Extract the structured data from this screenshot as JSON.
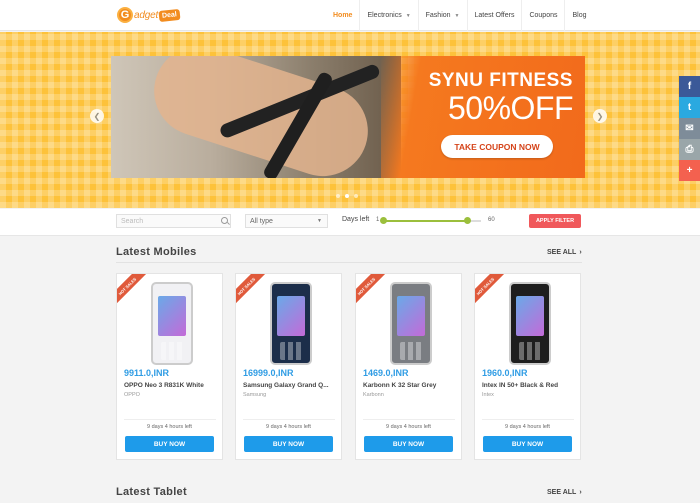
{
  "header": {
    "logo": {
      "word": "adget",
      "tag": "Deal"
    },
    "nav": [
      {
        "label": "Home",
        "active": true,
        "dropdown": false
      },
      {
        "label": "Electronics",
        "active": false,
        "dropdown": true
      },
      {
        "label": "Fashion",
        "active": false,
        "dropdown": true
      },
      {
        "label": "Latest Offers",
        "active": false,
        "dropdown": false
      },
      {
        "label": "Coupons",
        "active": false,
        "dropdown": false
      },
      {
        "label": "Blog",
        "active": false,
        "dropdown": false
      }
    ]
  },
  "hero": {
    "title": "SYNU FITNESS",
    "offer": "50%OFF",
    "cta": "TAKE COUPON NOW",
    "dots": 3,
    "active_dot": 1,
    "colors": {
      "background": "#fdc23a",
      "banner": "#f26a1b"
    }
  },
  "social": [
    {
      "icon": "facebook-icon",
      "glyph": "f",
      "color": "#3b5998"
    },
    {
      "icon": "twitter-icon",
      "glyph": "t",
      "color": "#2aa9e0"
    },
    {
      "icon": "mail-icon",
      "glyph": "✉",
      "color": "#7e8c99"
    },
    {
      "icon": "print-icon",
      "glyph": "⎙",
      "color": "#9aa6a9"
    },
    {
      "icon": "plus-icon",
      "glyph": "+",
      "color": "#f4614f"
    }
  ],
  "filter": {
    "search_placeholder": "Search",
    "type_selected": "All type",
    "days_label": "Days left",
    "slider_min": "1",
    "slider_max": "60",
    "slider_range": [
      1,
      52
    ],
    "apply_label": "APPLY FILTER"
  },
  "sections": {
    "mobiles_title": "Latest Mobiles",
    "tablets_title": "Latest Tablet",
    "see_all": "SEE ALL"
  },
  "products": [
    {
      "ribbon": "HOT SALES",
      "price": "9911.0,INR",
      "name": "OPPO Neo 3 R831K White",
      "brand": "OPPO",
      "time_left": "9 days 4 hours left",
      "buy": "BUY NOW",
      "phone_color": "#f1f1f4"
    },
    {
      "ribbon": "HOT SALES",
      "price": "16999.0,INR",
      "name": "Samsung Galaxy Grand Q...",
      "brand": "Samsung",
      "time_left": "9 days 4 hours left",
      "buy": "BUY NOW",
      "phone_color": "#1c2e4a"
    },
    {
      "ribbon": "HOT SALES",
      "price": "1469.0,INR",
      "name": "Karbonn K 32 Star Grey",
      "brand": "Karbonn",
      "time_left": "9 days 4 hours left",
      "buy": "BUY NOW",
      "phone_color": "#7a7d82"
    },
    {
      "ribbon": "HOT SALES",
      "price": "1960.0,INR",
      "name": "Intex IN 50+ Black & Red",
      "brand": "Intex",
      "time_left": "9 days 4 hours left",
      "buy": "BUY NOW",
      "phone_color": "#1e1e1e"
    }
  ]
}
